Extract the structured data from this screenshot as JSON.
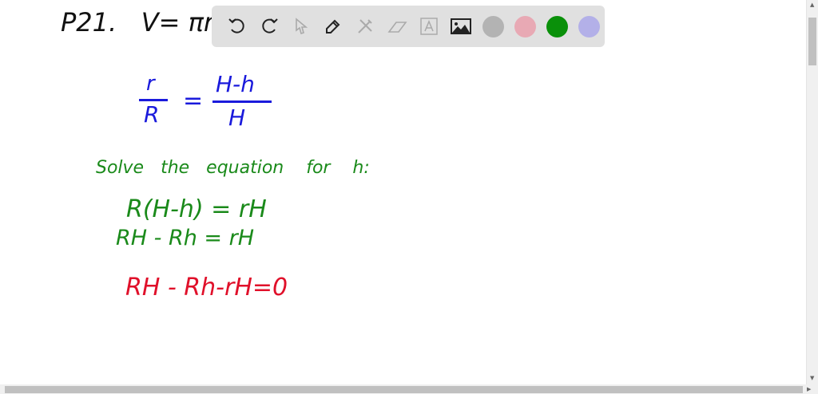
{
  "canvas": {
    "lines": [
      {
        "id": "problem",
        "text": "P21.   V= πr",
        "color": "#111111"
      },
      {
        "id": "frac-left-num",
        "text": "r",
        "color": "#1a1adc"
      },
      {
        "id": "frac-left-den",
        "text": "R",
        "color": "#1a1adc"
      },
      {
        "id": "equals",
        "text": "=",
        "color": "#1a1adc"
      },
      {
        "id": "frac-right-num",
        "text": "H-h",
        "color": "#1a1adc"
      },
      {
        "id": "frac-right-den",
        "text": "H",
        "color": "#1a1adc"
      },
      {
        "id": "solve",
        "text": "Solve   the   equation    for    h:",
        "color": "#1a8a1a"
      },
      {
        "id": "step1",
        "text": "R(H-h) = rH",
        "color": "#1a8a1a"
      },
      {
        "id": "step2",
        "text": "RH - Rh = rH",
        "color": "#1a8a1a"
      },
      {
        "id": "step3",
        "text": "RH - Rh-rH=0",
        "color": "#e0102a"
      }
    ]
  },
  "toolbar": {
    "tools": [
      "undo-icon",
      "redo-icon",
      "select-icon",
      "pen-icon",
      "tools-icon",
      "eraser-icon",
      "text-icon",
      "image-icon"
    ],
    "colors": [
      "#b3b3b3",
      "#e8a9b4",
      "#0a900a",
      "#b3b0e8"
    ]
  }
}
